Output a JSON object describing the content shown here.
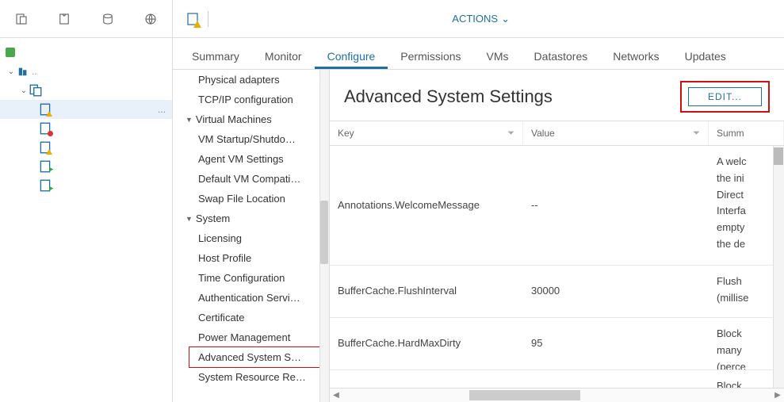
{
  "header": {
    "actions_label": "ACTIONS",
    "chevron": "⌄"
  },
  "tabs": [
    {
      "label": "Summary"
    },
    {
      "label": "Monitor"
    },
    {
      "label": "Configure"
    },
    {
      "label": "Permissions"
    },
    {
      "label": "VMs"
    },
    {
      "label": "Datastores"
    },
    {
      "label": "Networks"
    },
    {
      "label": "Updates"
    }
  ],
  "config_nav": {
    "items_top": [
      "Physical adapters",
      "TCP/IP configuration"
    ],
    "vm_group": "Virtual Machines",
    "vm_items": [
      "VM Startup/Shutdo…",
      "Agent VM Settings",
      "Default VM Compati…",
      "Swap File Location"
    ],
    "sys_group": "System",
    "sys_items": [
      "Licensing",
      "Host Profile",
      "Time Configuration",
      "Authentication Servi…",
      "Certificate",
      "Power Management",
      "Advanced System S…",
      "System Resource Re…"
    ]
  },
  "panel": {
    "title": "Advanced System Settings",
    "edit": "EDIT..."
  },
  "table": {
    "headers": {
      "key": "Key",
      "value": "Value",
      "summary": "Summ"
    },
    "rows": [
      {
        "key": "Annotations.WelcomeMessage",
        "value": "--",
        "summary": "A welc\nthe ini\nDirect\nInterfa\nempty\nthe de"
      },
      {
        "key": "BufferCache.FlushInterval",
        "value": "30000",
        "summary": "Flush\n(millise"
      },
      {
        "key": "BufferCache.HardMaxDirty",
        "value": "95",
        "summary": "Block\nmany\n(perce"
      },
      {
        "key": "",
        "value": "",
        "summary": "Block"
      }
    ]
  }
}
